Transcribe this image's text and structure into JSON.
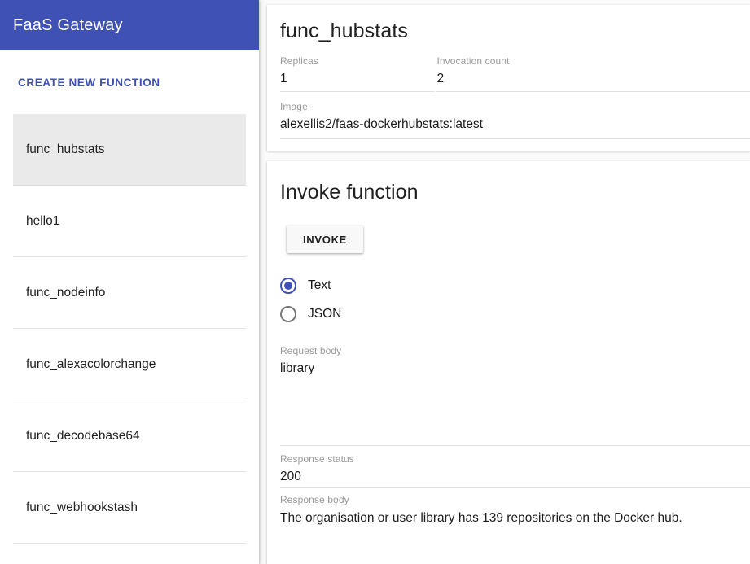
{
  "sidebar": {
    "title": "FaaS Gateway",
    "create_button": "CREATE NEW FUNCTION",
    "functions": [
      {
        "name": "func_hubstats",
        "selected": true
      },
      {
        "name": "hello1",
        "selected": false
      },
      {
        "name": "func_nodeinfo",
        "selected": false
      },
      {
        "name": "func_alexacolorchange",
        "selected": false
      },
      {
        "name": "func_decodebase64",
        "selected": false
      },
      {
        "name": "func_webhookstash",
        "selected": false
      }
    ]
  },
  "detail": {
    "title": "func_hubstats",
    "replicas_label": "Replicas",
    "replicas_value": "1",
    "invocations_label": "Invocation count",
    "invocations_value": "2",
    "image_label": "Image",
    "image_value": "alexellis2/faas-dockerhubstats:latest"
  },
  "invoke": {
    "heading": "Invoke function",
    "button_label": "INVOKE",
    "format_options": [
      {
        "label": "Text",
        "checked": true
      },
      {
        "label": "JSON",
        "checked": false
      }
    ],
    "request_body_label": "Request body",
    "request_body_value": "library",
    "response_status_label": "Response status",
    "response_status_value": "200",
    "response_body_label": "Response body",
    "response_body_value": "The organisation or user library has 139 repositories on the Docker hub."
  },
  "colors": {
    "primary": "#3f51b5",
    "selected_item_bg": "#eaeaea",
    "page_bg": "#fafafa",
    "card_bg": "#ffffff"
  }
}
